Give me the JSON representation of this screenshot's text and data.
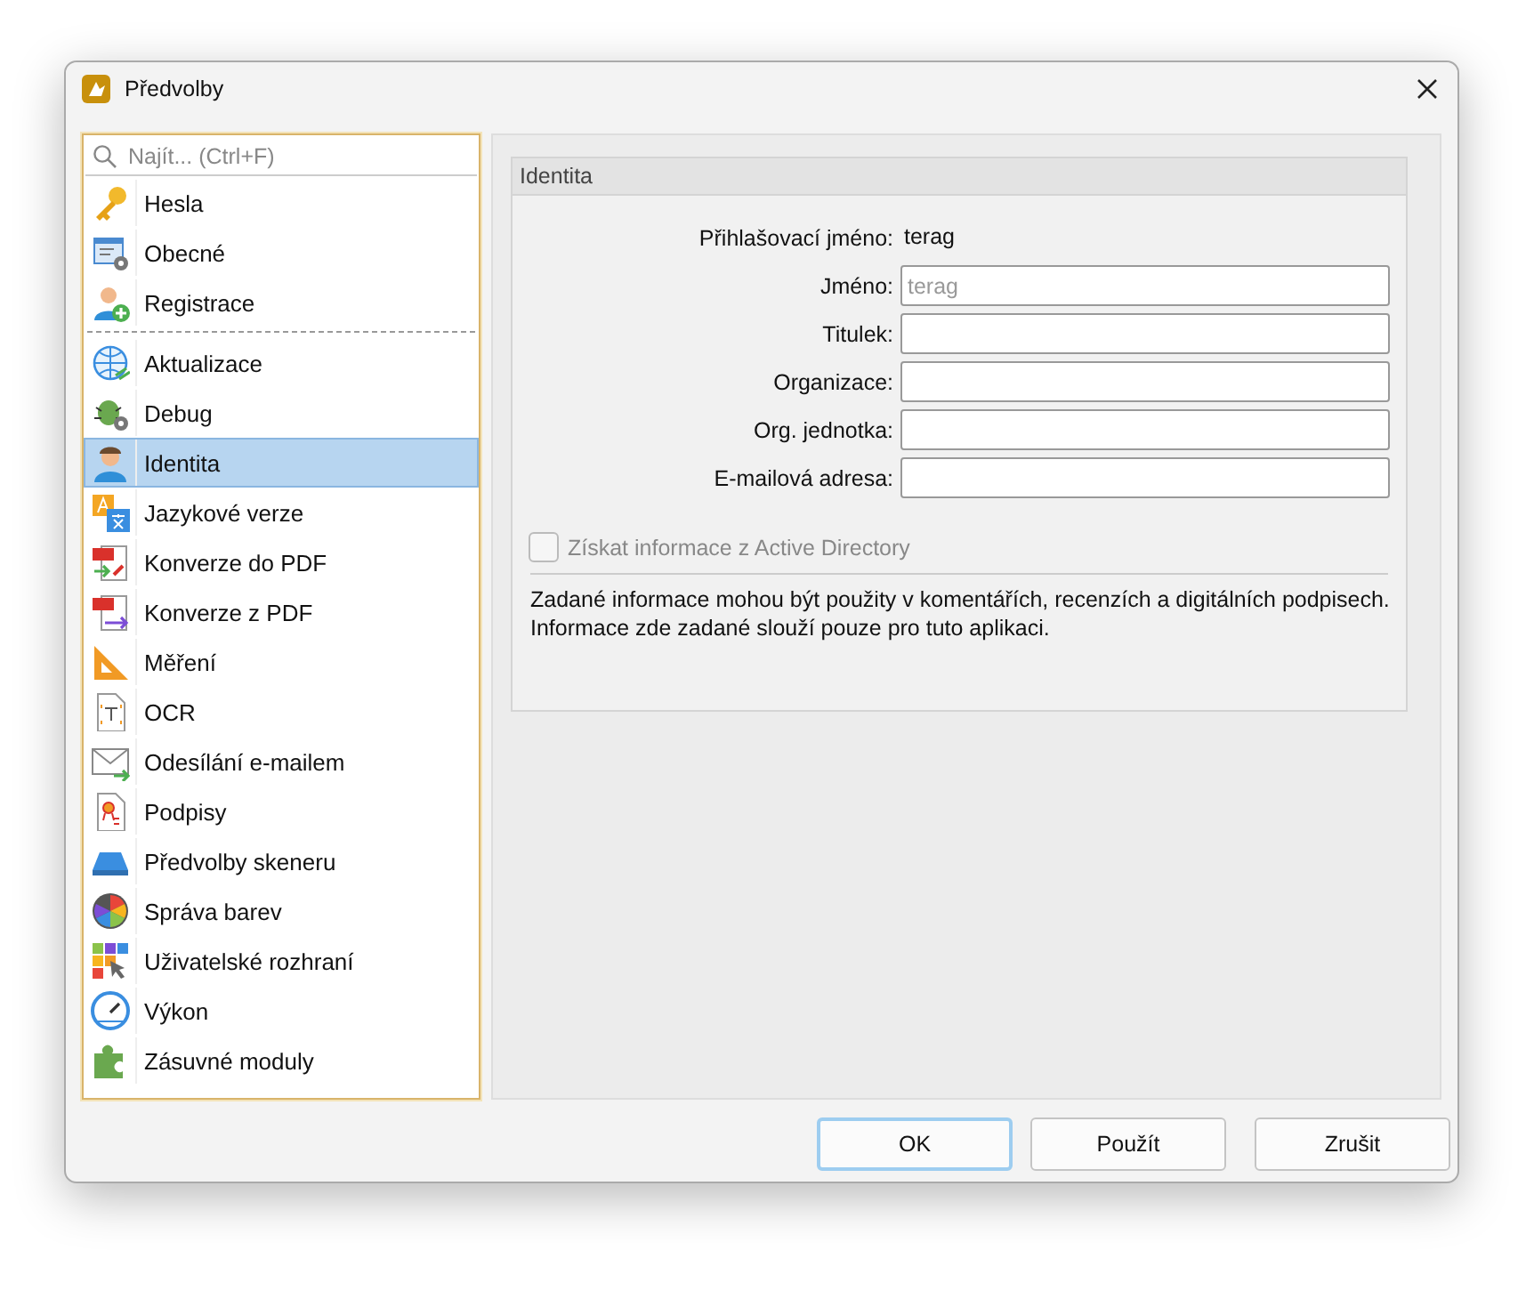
{
  "window": {
    "title": "Předvolby"
  },
  "search": {
    "placeholder": "Najít... (Ctrl+F)"
  },
  "sidebar": {
    "groups": [
      [
        {
          "label": "Hesla",
          "selected": false
        },
        {
          "label": "Obecné",
          "selected": false
        },
        {
          "label": "Registrace",
          "selected": false
        }
      ],
      [
        {
          "label": "Aktualizace",
          "selected": false
        },
        {
          "label": "Debug",
          "selected": false
        },
        {
          "label": "Identita",
          "selected": true
        },
        {
          "label": "Jazykové verze",
          "selected": false
        },
        {
          "label": "Konverze do PDF",
          "selected": false
        },
        {
          "label": "Konverze z PDF",
          "selected": false
        },
        {
          "label": "Měření",
          "selected": false
        },
        {
          "label": "OCR",
          "selected": false
        },
        {
          "label": "Odesílání e-mailem",
          "selected": false
        },
        {
          "label": "Podpisy",
          "selected": false
        },
        {
          "label": "Předvolby skeneru",
          "selected": false
        },
        {
          "label": "Správa barev",
          "selected": false
        },
        {
          "label": "Uživatelské rozhraní",
          "selected": false
        },
        {
          "label": "Výkon",
          "selected": false
        },
        {
          "label": "Zásuvné moduly",
          "selected": false
        }
      ]
    ]
  },
  "group": {
    "title": "Identita",
    "fields": [
      {
        "kind": "text",
        "label": "Přihlašovací jméno:",
        "value": "terag"
      },
      {
        "kind": "input",
        "label": "Jméno:",
        "placeholder": "terag"
      },
      {
        "kind": "input",
        "label": "Titulek:"
      },
      {
        "kind": "input",
        "label": "Organizace:"
      },
      {
        "kind": "input",
        "label": "Org. jednotka:"
      },
      {
        "kind": "input",
        "label": "E-mailová adresa:"
      }
    ],
    "checkbox": {
      "label": "Získat informace z Active Directory",
      "checked": false,
      "disabled": true
    },
    "note_lines": [
      "Zadané informace mohou být použity v komentářích, recenzích a digitálních podpisech.",
      "Informace zde zadané slouží pouze pro tuto aplikaci."
    ]
  },
  "buttons": [
    {
      "label": "OK",
      "default": true
    },
    {
      "label": "Použít",
      "default": false
    },
    {
      "label": "Zrušit",
      "default": false
    }
  ]
}
